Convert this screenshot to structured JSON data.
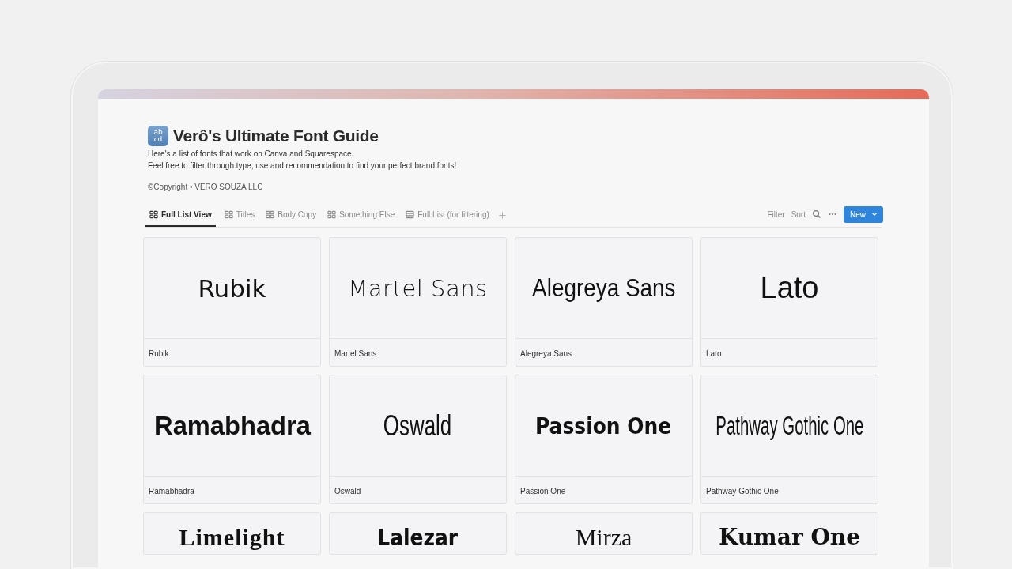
{
  "page": {
    "icon_lines": [
      "ab",
      "cd"
    ],
    "title": "Verô's Ultimate Font Guide",
    "description": [
      "Here's a list of fonts that work on Canva and Squarespace.",
      "Feel free to filter through type, use and recommendation to find your perfect brand fonts!"
    ],
    "copyright": "©Copyright • VERO SOUZA LLC"
  },
  "tabs": [
    {
      "label": "Full List View",
      "kind": "gallery",
      "selected": true
    },
    {
      "label": "Titles",
      "kind": "gallery",
      "selected": false
    },
    {
      "label": "Body Copy",
      "kind": "gallery",
      "selected": false
    },
    {
      "label": "Something Else",
      "kind": "gallery",
      "selected": false
    },
    {
      "label": "Full List (for filtering)",
      "kind": "table",
      "selected": false
    }
  ],
  "toolbar": {
    "filter": "Filter",
    "sort": "Sort",
    "new_button": "New"
  },
  "cards": [
    {
      "preview": "Rubik",
      "name": "Rubik",
      "kind": "rounded"
    },
    {
      "preview": "Martel Sans",
      "name": "Martel Sans",
      "kind": "light"
    },
    {
      "preview": "Alegreya Sans",
      "name": "Alegreya Sans",
      "kind": "humanist"
    },
    {
      "preview": "Lato",
      "name": "Lato",
      "kind": "regular"
    },
    {
      "preview": "Ramabhadra",
      "name": "Ramabhadra",
      "kind": "heavy"
    },
    {
      "preview": "Oswald",
      "name": "Oswald",
      "kind": "condensed"
    },
    {
      "preview": "Passion One",
      "name": "Passion One",
      "kind": "black"
    },
    {
      "preview": "Pathway Gothic One",
      "name": "Pathway Gothic One",
      "kind": "narrow"
    },
    {
      "preview": "Limelight",
      "kind": "display"
    },
    {
      "preview": "Lalezar",
      "kind": "black"
    },
    {
      "preview": "Mirza",
      "kind": "serif"
    },
    {
      "preview": "Kumar One",
      "kind": "slab"
    }
  ]
}
